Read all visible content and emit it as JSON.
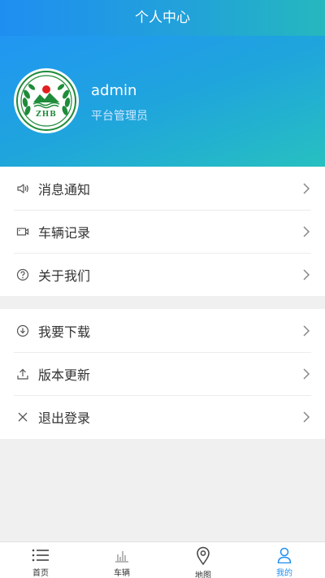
{
  "app": {
    "title": "个人中心"
  },
  "profile": {
    "username": "admin",
    "role": "平台管理员",
    "logo_text": "ZHB"
  },
  "menu": {
    "group1": [
      {
        "label": "消息通知",
        "icon": "speaker-icon"
      },
      {
        "label": "车辆记录",
        "icon": "camera-icon"
      },
      {
        "label": "关于我们",
        "icon": "question-icon"
      }
    ],
    "group2": [
      {
        "label": "我要下载",
        "icon": "download-icon"
      },
      {
        "label": "版本更新",
        "icon": "upload-icon"
      },
      {
        "label": "退出登录",
        "icon": "close-icon"
      }
    ]
  },
  "tabbar": {
    "tabs": [
      {
        "label": "首页",
        "icon": "list-icon"
      },
      {
        "label": "车辆",
        "icon": "bar-chart-icon"
      },
      {
        "label": "地图",
        "icon": "map-pin-icon"
      },
      {
        "label": "我的",
        "icon": "user-icon",
        "active": true
      }
    ]
  },
  "colors": {
    "primary": "#1f8ef1",
    "header_gradient_end": "#27c0c0",
    "background": "#f0f0f0"
  }
}
